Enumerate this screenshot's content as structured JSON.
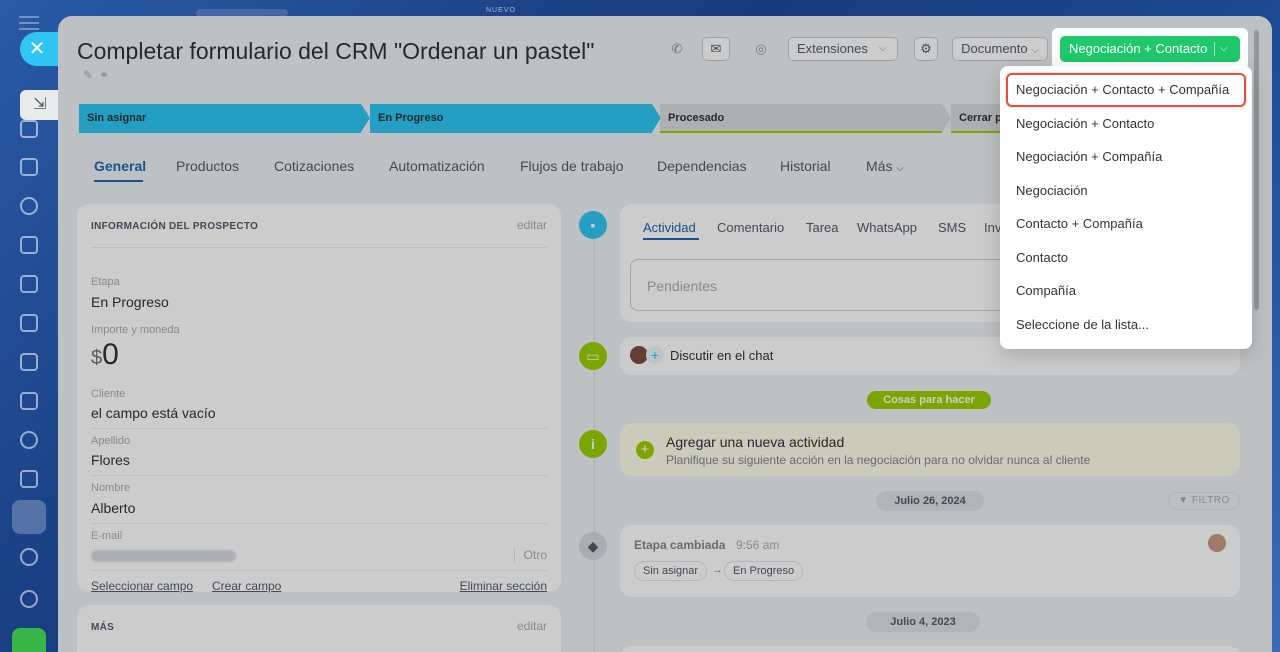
{
  "header": {
    "title": "Completar formulario del CRM \"Ordenar un pastel\"",
    "extensions": "Extensiones",
    "document": "Documento",
    "convert": "Negociación + Contacto",
    "new_badge": "NUEVO"
  },
  "stages": [
    {
      "label": "Sin asignar",
      "color": "#2fc6f6"
    },
    {
      "label": "En Progreso",
      "color": "#2fc6f6"
    },
    {
      "label": "Procesado",
      "color": "#d8dcdf"
    },
    {
      "label": "Cerrar p",
      "color": "#d8dcdf"
    }
  ],
  "tabs": [
    "General",
    "Productos",
    "Cotizaciones",
    "Automatización",
    "Flujos de trabajo",
    "Dependencias",
    "Historial",
    "Más"
  ],
  "lead_card": {
    "title": "INFORMACIÓN DEL PROSPECTO",
    "edit": "editar",
    "stage_label": "Etapa",
    "stage_value": "En Progreso",
    "amount_label": "Importe y moneda",
    "currency": "$",
    "amount": "0",
    "client_label": "Cliente",
    "client_value": "el campo está vacío",
    "lastname_label": "Apellido",
    "lastname_value": "Flores",
    "name_label": "Nombre",
    "name_value": "Alberto",
    "email_label": "E-mail",
    "email_type": "Otro",
    "select_field": "Seleccionar campo",
    "create_field": "Crear campo",
    "delete_section": "Eliminar sección"
  },
  "more_card": {
    "title": "MÁS",
    "edit": "editar"
  },
  "activity_tabs": [
    "Actividad",
    "Comentario",
    "Tarea",
    "WhatsApp",
    "SMS",
    "Inv"
  ],
  "pending_placeholder": "Pendientes",
  "chat": "Discutir en el chat",
  "todo_pill": "Cosas para hacer",
  "todo": {
    "title": "Agregar una nueva actividad",
    "subtitle": "Planifique su siguiente acción en la negociación para no olvidar nunca al cliente"
  },
  "date1": "Julio 26, 2024",
  "filter": "FILTRO",
  "event": {
    "title": "Etapa cambiada",
    "time": "9:56 am",
    "from": "Sin asignar",
    "arrow": "→",
    "to": "En Progreso"
  },
  "date2": "Julio 4, 2023",
  "dropdown": [
    "Negociación + Contacto + Compañía",
    "Negociación + Contacto",
    "Negociación + Compañía",
    "Negociación",
    "Contacto + Compañía",
    "Contacto",
    "Compañía",
    "Seleccione de la lista..."
  ]
}
